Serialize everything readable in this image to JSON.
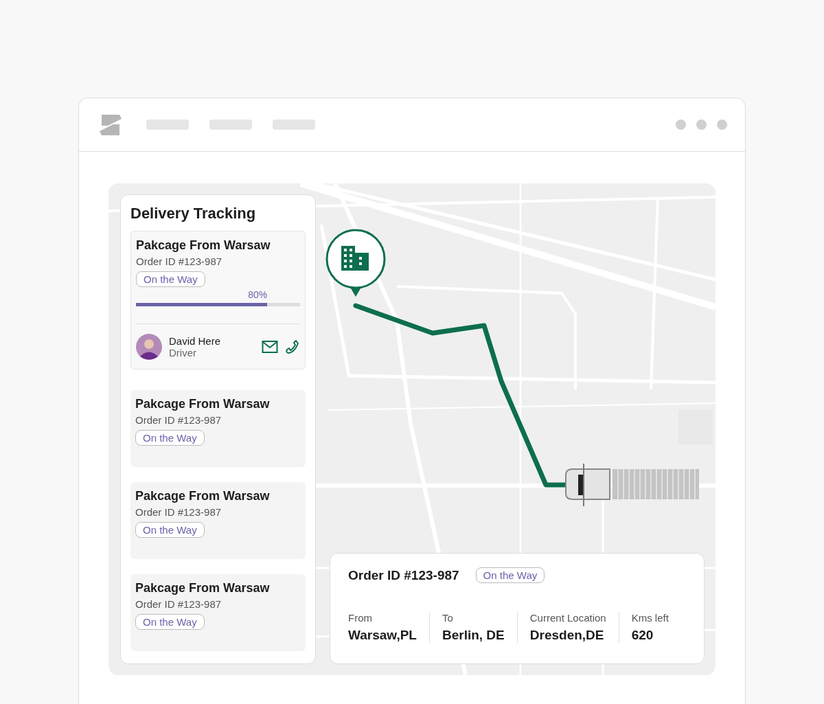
{
  "panel": {
    "title": "Delivery Tracking"
  },
  "deliveries": [
    {
      "title": "Pakcage From Warsaw",
      "order_id": "Order ID #123-987",
      "status": "On the Way",
      "expanded": true,
      "progress": {
        "level": 0.8,
        "reading": "80%"
      },
      "driver": {
        "name": "David Here",
        "role": "Driver"
      }
    },
    {
      "title": "Pakcage From Warsaw",
      "order_id": "Order ID #123-987",
      "status": "On the Way",
      "expanded": false
    },
    {
      "title": "Pakcage From Warsaw",
      "order_id": "Order ID #123-987",
      "status": "On the Way",
      "expanded": false
    },
    {
      "title": "Pakcage From Warsaw",
      "order_id": "Order ID #123-987",
      "status": "On the Way",
      "expanded": false
    }
  ],
  "order_card": {
    "order_id": "Order ID #123-987",
    "status": "On the Way",
    "fields": [
      {
        "label": "From",
        "value": "Warsaw,PL"
      },
      {
        "label": "To",
        "value": "Berlin, DE"
      },
      {
        "label": "Current Location",
        "value": "Dresden,DE"
      },
      {
        "label": "Kms left",
        "value": "620"
      }
    ]
  }
}
